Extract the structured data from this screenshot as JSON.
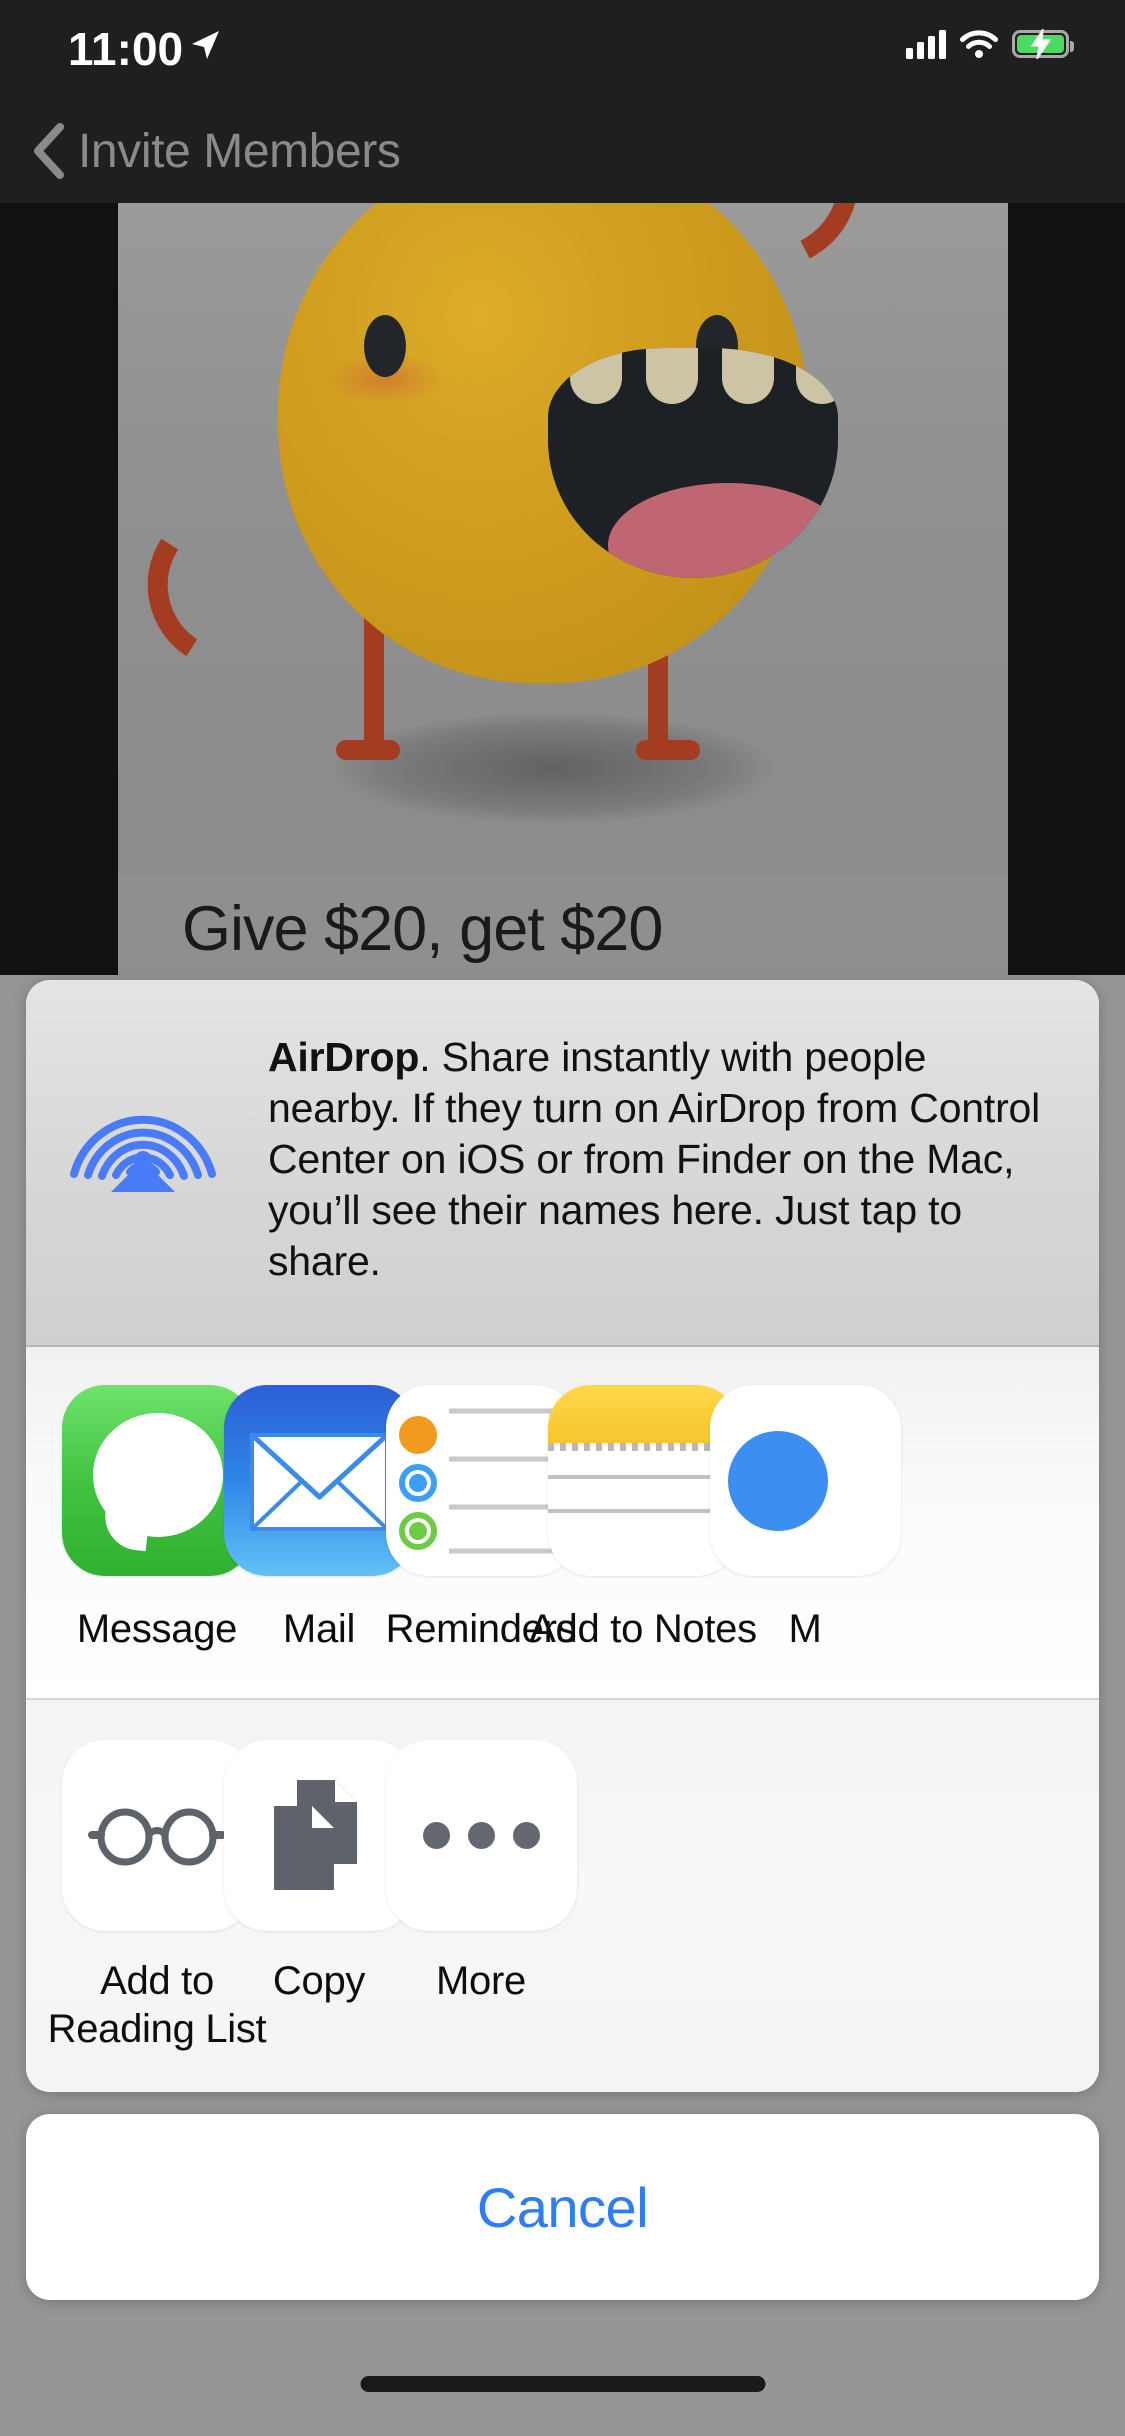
{
  "status_bar": {
    "time": "11:00",
    "location_icon": "location-arrow-icon",
    "signal_icon": "cellular-signal-icon",
    "wifi_icon": "wifi-icon",
    "battery_icon": "battery-charging-icon",
    "battery_color": "#4ED964"
  },
  "nav_bar": {
    "back_icon": "chevron-left-icon",
    "title": "Invite Members"
  },
  "background_content": {
    "promo_title": "Give $20, get $20",
    "illustration": "yellow-monster-illustration"
  },
  "share_sheet": {
    "airdrop": {
      "icon": "airdrop-icon",
      "icon_color": "#4A7BF7",
      "title": "AirDrop",
      "body": ". Share instantly with people nearby. If they turn on AirDrop from Control Center on iOS or from Finder on the Mac, you’ll see their names here. Just tap to share."
    },
    "apps": [
      {
        "label": "Message",
        "icon": "messages-app-icon",
        "color": "#40C040"
      },
      {
        "label": "Mail",
        "icon": "mail-app-icon",
        "color": "#2F86E8"
      },
      {
        "label": "Reminders",
        "icon": "reminders-app-icon",
        "color": "#FFFFFF"
      },
      {
        "label": "Add to Notes",
        "icon": "notes-app-icon",
        "color": "#F6C62C"
      },
      {
        "label": "M",
        "icon": "partial-app-icon",
        "color": "#3C8EF0"
      }
    ],
    "actions": [
      {
        "label": "Add to\nReading List",
        "label_line1": "Add to",
        "label_line2": "Reading List",
        "icon": "glasses-icon"
      },
      {
        "label": "Copy",
        "label_line1": "Copy",
        "label_line2": "",
        "icon": "copy-documents-icon"
      },
      {
        "label": "More",
        "label_line1": "More",
        "label_line2": "",
        "icon": "ellipsis-icon"
      }
    ],
    "cancel_label": "Cancel",
    "cancel_color": "#2E7CF6"
  },
  "home_indicator": "home-indicator-bar"
}
